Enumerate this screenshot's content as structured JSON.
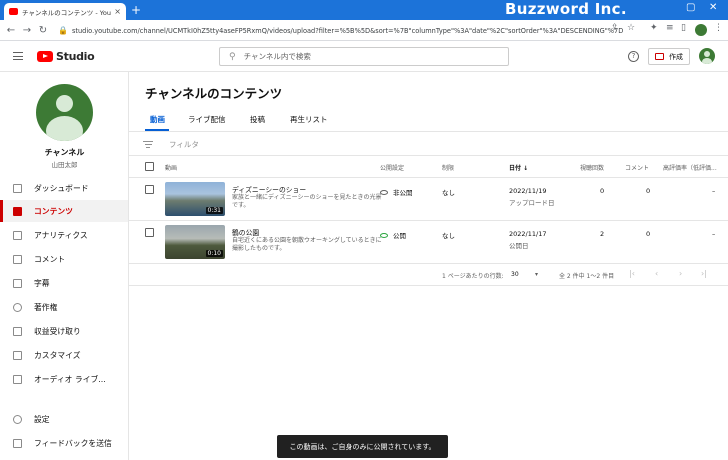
{
  "browser": {
    "tab_title": "チャンネルのコンテンツ - YouTube Stu",
    "tab_close": "×",
    "new_tab": "+",
    "brand_text": "Buzzword Inc.",
    "url": "studio.youtube.com/channel/UCMTkI0hZ5tty4aseFP5RxmQ/videos/upload?filter=%5B%5D&sort=%7B\"columnType\"%3A\"date\"%2C\"sortOrder\"%3A\"DESCENDING\"%7D"
  },
  "header": {
    "logo_text": "Studio",
    "search_placeholder": "チャンネル内で検索",
    "help": "?",
    "create_label": "作成"
  },
  "sidebar": {
    "channel_label": "チャンネル",
    "channel_name": "山田太郎",
    "items": [
      {
        "label": "ダッシュボード",
        "icon": "dashboard-icon"
      },
      {
        "label": "コンテンツ",
        "icon": "content-icon"
      },
      {
        "label": "アナリティクス",
        "icon": "analytics-icon"
      },
      {
        "label": "コメント",
        "icon": "comment-icon"
      },
      {
        "label": "字幕",
        "icon": "subtitles-icon"
      },
      {
        "label": "著作権",
        "icon": "copyright-icon"
      },
      {
        "label": "収益受け取り",
        "icon": "monetization-icon"
      },
      {
        "label": "カスタマイズ",
        "icon": "customize-icon"
      },
      {
        "label": "オーディオ ライブ...",
        "icon": "audio-library-icon"
      }
    ],
    "settings_label": "設定",
    "feedback_label": "フィードバックを送信"
  },
  "main": {
    "title": "チャンネルのコンテンツ",
    "tabs": [
      "動画",
      "ライブ配信",
      "投稿",
      "再生リスト"
    ],
    "filter_label": "フィルタ",
    "columns": {
      "video": "動画",
      "visibility": "公開設定",
      "restriction": "制限",
      "date": "日付 ↓",
      "views": "視聴回数",
      "comments": "コメント",
      "likes": "高評価率（低評価..."
    },
    "videos": [
      {
        "title": "ディズニーシーのショー",
        "description": "家族と一緒にディズニーシーのショーを見たときの光景です。",
        "duration": "0:31",
        "visibility": "非公開",
        "restriction": "なし",
        "date": "2022/11/19",
        "date_sub": "アップロード日",
        "views": "0",
        "comments": "0",
        "likes": "–"
      },
      {
        "title": "鶴の公園",
        "description": "自宅近くにある公園を朝散ウオーキングしているときに撮影したものです。",
        "duration": "0:10",
        "visibility": "公開",
        "restriction": "なし",
        "date": "2022/11/17",
        "date_sub": "公開日",
        "views": "2",
        "comments": "0",
        "likes": "–"
      }
    ],
    "pager": {
      "rows_label": "1 ページあたりの行数:",
      "rows_value": "30",
      "range": "全 2 件中 1～2 件目"
    }
  },
  "toast": "この動画は、ご自身のみに公開されています。",
  "colors": {
    "accent_red": "#cc0000",
    "tab_blue": "#065fd4",
    "browser_blue": "#1c73d9"
  }
}
